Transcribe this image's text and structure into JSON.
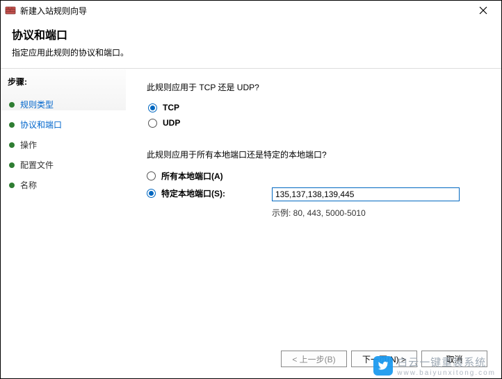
{
  "window": {
    "title": "新建入站规则向导"
  },
  "header": {
    "title": "协议和端口",
    "subtitle": "指定应用此规则的协议和端口。"
  },
  "sidebar": {
    "steps_label": "步骤:",
    "items": [
      {
        "label": "规则类型",
        "active": false
      },
      {
        "label": "协议和端口",
        "active": true
      },
      {
        "label": "操作",
        "active": false
      },
      {
        "label": "配置文件",
        "active": false
      },
      {
        "label": "名称",
        "active": false
      }
    ]
  },
  "content": {
    "protocol_question": "此规则应用于 TCP 还是 UDP?",
    "protocol_options": {
      "tcp": {
        "label": "TCP",
        "checked": true
      },
      "udp": {
        "label": "UDP",
        "checked": false
      }
    },
    "port_question": "此规则应用于所有本地端口还是特定的本地端口?",
    "port_options": {
      "all": {
        "label": "所有本地端口(A)",
        "checked": false
      },
      "specific": {
        "label": "特定本地端口(S):",
        "checked": true
      }
    },
    "port_value": "135,137,138,139,445",
    "example_label": "示例: 80, 443, 5000-5010"
  },
  "footer": {
    "back": "< 上一步(B)",
    "next": "下一页(N) >",
    "cancel": "取消"
  },
  "watermark": {
    "text1": "白云一键重装系统",
    "text2": "www.baiyunxitong.com"
  }
}
